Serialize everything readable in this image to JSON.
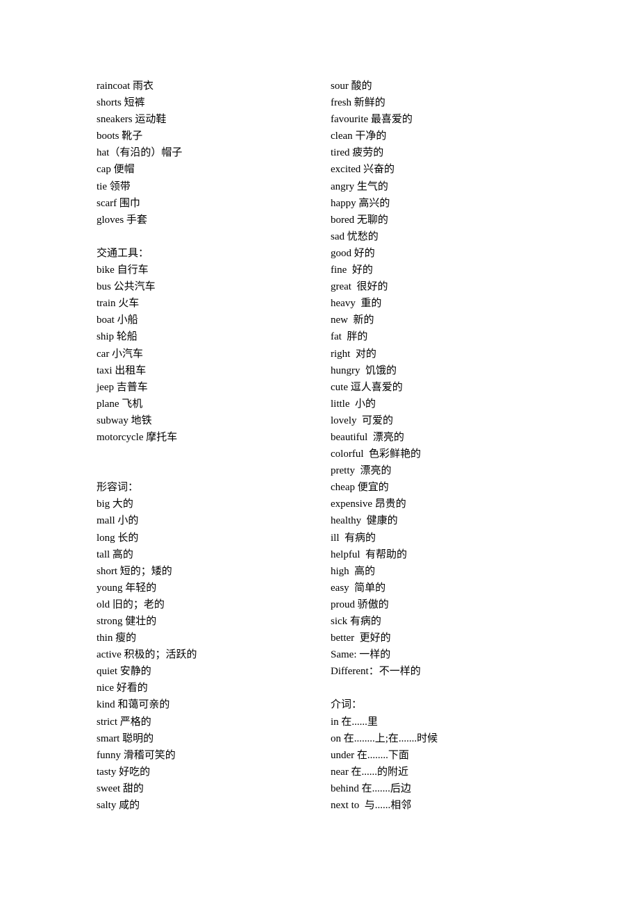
{
  "left_column": [
    {
      "type": "entry",
      "text": "raincoat 雨衣"
    },
    {
      "type": "entry",
      "text": "shorts 短裤"
    },
    {
      "type": "entry",
      "text": "sneakers 运动鞋"
    },
    {
      "type": "entry",
      "text": "boots 靴子"
    },
    {
      "type": "entry",
      "text": "hat（有沿的）帽子"
    },
    {
      "type": "entry",
      "text": "cap 便帽"
    },
    {
      "type": "entry",
      "text": "tie 领带"
    },
    {
      "type": "entry",
      "text": "scarf 围巾"
    },
    {
      "type": "entry",
      "text": "gloves 手套"
    },
    {
      "type": "blank",
      "text": ""
    },
    {
      "type": "heading",
      "text": "交通工具："
    },
    {
      "type": "entry",
      "text": "bike 自行车"
    },
    {
      "type": "entry",
      "text": "bus 公共汽车"
    },
    {
      "type": "entry",
      "text": "train 火车"
    },
    {
      "type": "entry",
      "text": "boat 小船"
    },
    {
      "type": "entry",
      "text": "ship 轮船"
    },
    {
      "type": "entry",
      "text": "car 小汽车"
    },
    {
      "type": "entry",
      "text": "taxi 出租车"
    },
    {
      "type": "entry",
      "text": "jeep 吉普车"
    },
    {
      "type": "entry",
      "text": "plane 飞机"
    },
    {
      "type": "entry",
      "text": "subway 地铁"
    },
    {
      "type": "entry",
      "text": "motorcycle 摩托车"
    },
    {
      "type": "blank",
      "text": ""
    },
    {
      "type": "blank",
      "text": ""
    },
    {
      "type": "heading",
      "text": "形容词："
    },
    {
      "type": "entry",
      "text": "big 大的"
    },
    {
      "type": "entry",
      "text": "mall 小的"
    },
    {
      "type": "entry",
      "text": "long 长的"
    },
    {
      "type": "entry",
      "text": "tall 高的"
    },
    {
      "type": "entry",
      "text": "short 短的；矮的"
    },
    {
      "type": "entry",
      "text": "young 年轻的"
    },
    {
      "type": "entry",
      "text": "old 旧的；老的"
    },
    {
      "type": "entry",
      "text": "strong 健壮的"
    },
    {
      "type": "entry",
      "text": "thin 瘦的"
    },
    {
      "type": "entry",
      "text": "active 积极的；活跃的"
    },
    {
      "type": "entry",
      "text": "quiet 安静的"
    },
    {
      "type": "entry",
      "text": "nice 好看的"
    },
    {
      "type": "entry",
      "text": "kind 和蔼可亲的"
    },
    {
      "type": "entry",
      "text": "strict 严格的"
    },
    {
      "type": "entry",
      "text": "smart 聪明的"
    },
    {
      "type": "entry",
      "text": "funny 滑稽可笑的"
    },
    {
      "type": "entry",
      "text": "tasty 好吃的"
    },
    {
      "type": "entry",
      "text": "sweet 甜的"
    },
    {
      "type": "entry",
      "text": "salty 咸的"
    }
  ],
  "right_column": [
    {
      "type": "entry",
      "text": "sour 酸的"
    },
    {
      "type": "entry",
      "text": "fresh 新鲜的"
    },
    {
      "type": "entry",
      "text": "favourite 最喜爱的"
    },
    {
      "type": "entry",
      "text": "clean 干净的"
    },
    {
      "type": "entry",
      "text": "tired 疲劳的"
    },
    {
      "type": "entry",
      "text": "excited 兴奋的"
    },
    {
      "type": "entry",
      "text": "angry 生气的"
    },
    {
      "type": "entry",
      "text": "happy 高兴的"
    },
    {
      "type": "entry",
      "text": "bored 无聊的"
    },
    {
      "type": "entry",
      "text": "sad 忧愁的"
    },
    {
      "type": "entry",
      "text": "good 好的"
    },
    {
      "type": "entry",
      "text": "fine  好的"
    },
    {
      "type": "entry",
      "text": "great  很好的"
    },
    {
      "type": "entry",
      "text": "heavy  重的"
    },
    {
      "type": "entry",
      "text": "new  新的"
    },
    {
      "type": "entry",
      "text": "fat  胖的"
    },
    {
      "type": "entry",
      "text": "right  对的"
    },
    {
      "type": "entry",
      "text": "hungry  饥饿的"
    },
    {
      "type": "entry",
      "text": "cute 逗人喜爱的"
    },
    {
      "type": "entry",
      "text": "little  小的"
    },
    {
      "type": "entry",
      "text": "lovely  可爱的"
    },
    {
      "type": "entry",
      "text": "beautiful  漂亮的"
    },
    {
      "type": "entry",
      "text": "colorful  色彩鲜艳的"
    },
    {
      "type": "entry",
      "text": "pretty  漂亮的"
    },
    {
      "type": "entry",
      "text": "cheap 便宜的"
    },
    {
      "type": "entry",
      "text": "expensive 昂贵的"
    },
    {
      "type": "entry",
      "text": "healthy  健康的"
    },
    {
      "type": "entry",
      "text": "ill  有病的"
    },
    {
      "type": "entry",
      "text": "helpful  有帮助的"
    },
    {
      "type": "entry",
      "text": "high  高的"
    },
    {
      "type": "entry",
      "text": "easy  简单的"
    },
    {
      "type": "entry",
      "text": "proud 骄傲的"
    },
    {
      "type": "entry",
      "text": "sick 有病的"
    },
    {
      "type": "entry",
      "text": "better  更好的"
    },
    {
      "type": "entry",
      "text": "Same: 一样的"
    },
    {
      "type": "entry",
      "text": "Different：不一样的"
    },
    {
      "type": "blank",
      "text": ""
    },
    {
      "type": "heading",
      "text": "介词："
    },
    {
      "type": "entry",
      "text": "in 在......里"
    },
    {
      "type": "entry",
      "text": "on 在........上;在.......时候"
    },
    {
      "type": "entry",
      "text": "under 在........下面"
    },
    {
      "type": "entry",
      "text": "near 在......的附近"
    },
    {
      "type": "entry",
      "text": "behind 在.......后边"
    },
    {
      "type": "entry",
      "text": "next to  与......相邻"
    }
  ]
}
